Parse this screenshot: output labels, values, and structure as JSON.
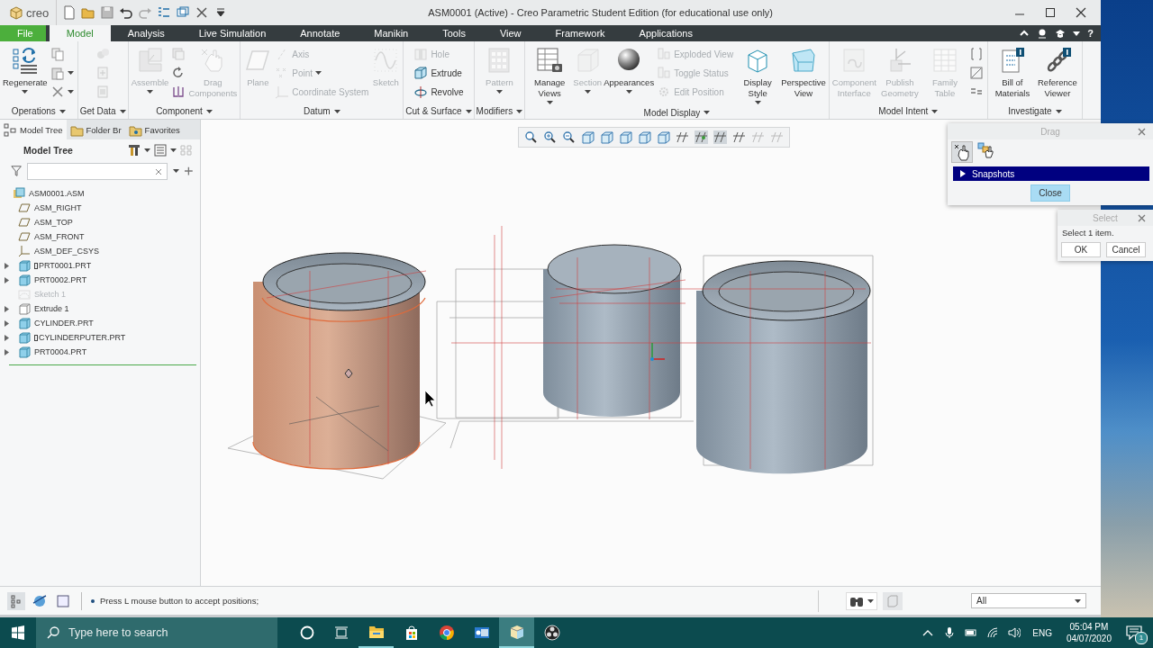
{
  "window": {
    "logo": "creo",
    "title": "ASM0001 (Active) - Creo Parametric Student Edition (for educational use only)"
  },
  "menu_tabs": [
    {
      "label": "File",
      "kind": "file",
      "selected": false
    },
    {
      "label": "Model",
      "kind": "tab",
      "selected": true
    },
    {
      "label": "Analysis",
      "kind": "tab",
      "selected": false
    },
    {
      "label": "Live Simulation",
      "kind": "tab",
      "selected": false
    },
    {
      "label": "Annotate",
      "kind": "tab",
      "selected": false
    },
    {
      "label": "Manikin",
      "kind": "tab",
      "selected": false
    },
    {
      "label": "Tools",
      "kind": "tab",
      "selected": false
    },
    {
      "label": "View",
      "kind": "tab",
      "selected": false
    },
    {
      "label": "Framework",
      "kind": "tab",
      "selected": false
    },
    {
      "label": "Applications",
      "kind": "tab",
      "selected": false
    }
  ],
  "help_label": "?",
  "ribbon": {
    "groups": [
      {
        "label": "Operations",
        "items": [
          {
            "kind": "large",
            "label": "Regenerate",
            "disabled": false,
            "dropdown": true
          },
          {
            "kind": "icon",
            "disabled": false,
            "dropdown": false
          },
          {
            "kind": "icon",
            "disabled": false,
            "dropdown": true
          },
          {
            "kind": "icon",
            "disabled": false,
            "dropdown": true
          }
        ]
      },
      {
        "label": "Get Data",
        "items": [
          {
            "kind": "icon",
            "disabled": true,
            "dropdown": false
          },
          {
            "kind": "icon",
            "disabled": true,
            "dropdown": false
          },
          {
            "kind": "icon",
            "disabled": true,
            "dropdown": false
          }
        ]
      },
      {
        "label": "Component",
        "items": [
          {
            "kind": "large",
            "label": "Assemble",
            "disabled": true,
            "dropdown": true
          },
          {
            "kind": "icon",
            "disabled": true,
            "dropdown": false
          },
          {
            "kind": "icon",
            "disabled": false,
            "dropdown": false
          },
          {
            "kind": "icon",
            "disabled": false,
            "dropdown": false
          },
          {
            "kind": "large",
            "label": "Drag Components",
            "disabled": true,
            "dropdown": false
          }
        ]
      },
      {
        "label": "Datum",
        "items": [
          {
            "kind": "large",
            "label": "Plane",
            "disabled": true,
            "dropdown": false
          },
          {
            "kind": "small",
            "label": "Axis",
            "disabled": true,
            "dropdown": false
          },
          {
            "kind": "small",
            "label": "Point",
            "disabled": true,
            "dropdown": true
          },
          {
            "kind": "small",
            "label": "Coordinate System",
            "disabled": true,
            "dropdown": false
          },
          {
            "kind": "large",
            "label": "Sketch",
            "disabled": true,
            "dropdown": false
          }
        ]
      },
      {
        "label": "Cut & Surface",
        "items": [
          {
            "kind": "small",
            "label": "Hole",
            "disabled": true,
            "dropdown": false
          },
          {
            "kind": "small",
            "label": "Extrude",
            "disabled": false,
            "dropdown": false
          },
          {
            "kind": "small",
            "label": "Revolve",
            "disabled": false,
            "dropdown": false
          }
        ]
      },
      {
        "label": "Modifiers",
        "items": [
          {
            "kind": "large",
            "label": "Pattern",
            "disabled": true,
            "dropdown": true
          }
        ]
      },
      {
        "label": "Model Display",
        "items": [
          {
            "kind": "large",
            "label": "Manage Views",
            "disabled": false,
            "dropdown": true
          },
          {
            "kind": "large",
            "label": "Section",
            "disabled": true,
            "dropdown": true
          },
          {
            "kind": "large",
            "label": "Appearances",
            "disabled": false,
            "dropdown": true
          },
          {
            "kind": "small",
            "label": "Exploded View",
            "disabled": true,
            "dropdown": false
          },
          {
            "kind": "small",
            "label": "Toggle Status",
            "disabled": true,
            "dropdown": false
          },
          {
            "kind": "small",
            "label": "Edit Position",
            "disabled": true,
            "dropdown": false
          },
          {
            "kind": "large",
            "label": "Display Style",
            "disabled": false,
            "dropdown": true
          },
          {
            "kind": "large",
            "label": "Perspective View",
            "disabled": false,
            "dropdown": false
          }
        ]
      },
      {
        "label": "Model Intent",
        "items": [
          {
            "kind": "large",
            "label": "Component Interface",
            "disabled": true,
            "dropdown": false
          },
          {
            "kind": "large",
            "label": "Publish Geometry",
            "disabled": true,
            "dropdown": false
          },
          {
            "kind": "large",
            "label": "Family Table",
            "disabled": true,
            "dropdown": false
          },
          {
            "kind": "icon",
            "disabled": false,
            "dropdown": false
          },
          {
            "kind": "icon",
            "disabled": false,
            "dropdown": false
          },
          {
            "kind": "icon",
            "disabled": false,
            "dropdown": false
          }
        ]
      },
      {
        "label": "Investigate",
        "items": [
          {
            "kind": "large",
            "label": "Bill of Materials",
            "disabled": false,
            "dropdown": false
          },
          {
            "kind": "large",
            "label": "Reference Viewer",
            "disabled": false,
            "dropdown": false
          }
        ]
      }
    ]
  },
  "model_tree": {
    "tabs": [
      {
        "label": "Model Tree",
        "selected": true
      },
      {
        "label": "Folder Br",
        "selected": false
      },
      {
        "label": "Favorites",
        "selected": false
      }
    ],
    "title": "Model Tree",
    "items": [
      {
        "label": "ASM0001.ASM",
        "kind": "assembly",
        "children": [
          {
            "label": "ASM_RIGHT",
            "kind": "plane",
            "disabled": false,
            "marked": false
          },
          {
            "label": "ASM_TOP",
            "kind": "plane",
            "disabled": false,
            "marked": false
          },
          {
            "label": "ASM_FRONT",
            "kind": "plane",
            "disabled": false,
            "marked": false
          },
          {
            "label": "ASM_DEF_CSYS",
            "kind": "csys",
            "disabled": false,
            "marked": false
          },
          {
            "label": "PRT0001.PRT",
            "kind": "part",
            "expanded": false,
            "disabled": false,
            "marked": true
          },
          {
            "label": "PRT0002.PRT",
            "kind": "part",
            "expanded": false,
            "disabled": false,
            "marked": false
          },
          {
            "label": "Sketch 1",
            "kind": "sketch",
            "disabled": true,
            "marked": false
          },
          {
            "label": "Extrude 1",
            "kind": "feature",
            "expanded": false,
            "disabled": false,
            "marked": false
          },
          {
            "label": "CYLINDER.PRT",
            "kind": "part",
            "expanded": false,
            "disabled": false,
            "marked": false
          },
          {
            "label": "CYLINDERPUTER.PRT",
            "kind": "part",
            "expanded": false,
            "disabled": false,
            "marked": true
          },
          {
            "label": "PRT0004.PRT",
            "kind": "part",
            "expanded": false,
            "disabled": false,
            "marked": false
          }
        ]
      }
    ]
  },
  "drag_dialog": {
    "title": "Drag",
    "tools": [
      {
        "selected": true
      },
      {
        "selected": false
      }
    ],
    "snapshots": {
      "label": "Snapshots",
      "expanded": false
    },
    "close_button": "Close"
  },
  "select_dialog": {
    "title": "Select",
    "message": "Select 1 item.",
    "buttons": [
      "OK",
      "Cancel"
    ]
  },
  "status_bar": {
    "message": "Press L mouse button to accept positions;",
    "filter": {
      "value": "All"
    }
  },
  "taskbar": {
    "search_placeholder": "Type here to search",
    "apps": [
      {
        "selected": false,
        "running": true
      },
      {
        "selected": false,
        "running": false
      },
      {
        "selected": false,
        "running": false
      },
      {
        "selected": false,
        "running": false
      },
      {
        "selected": true,
        "running": true
      },
      {
        "selected": false,
        "running": false
      }
    ],
    "language": "ENG",
    "time": "05:04 PM",
    "date": "04/07/2020",
    "notification_count": "1"
  }
}
